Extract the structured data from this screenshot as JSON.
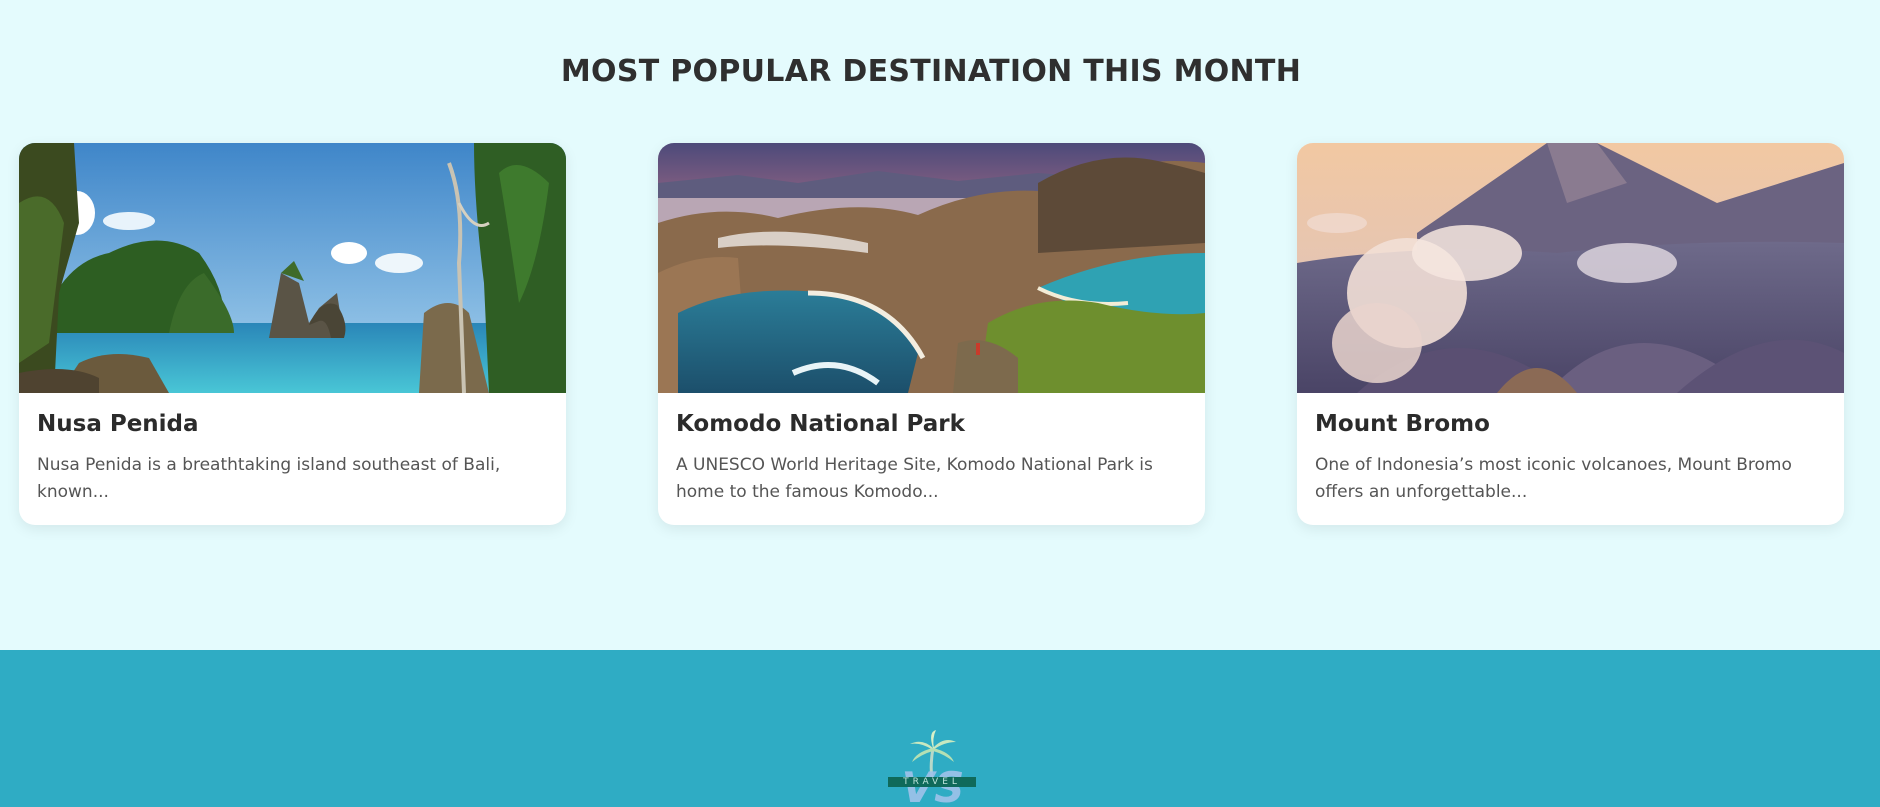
{
  "section": {
    "title": "MOST POPULAR DESTINATION THIS MONTH"
  },
  "cards": [
    {
      "title": "Nusa Penida",
      "description": "Nusa Penida is a breathtaking island southeast of Bali, known...",
      "image": "nusa-penida-photo"
    },
    {
      "title": "Komodo National Park",
      "description": "A UNESCO World Heritage Site, Komodo National Park is home to the famous Komodo...",
      "image": "komodo-national-park-photo"
    },
    {
      "title": "Mount Bromo",
      "description": "One of Indonesia’s most iconic volcanoes, Mount Bromo offers an unforgettable...",
      "image": "mount-bromo-photo"
    }
  ],
  "footer": {
    "logo_letters": "VS",
    "logo_word": "TRAVEL",
    "logo_icon": "palm-tree-icon"
  },
  "colors": {
    "page_background": "#e4fbfd",
    "footer_background": "#2facc4",
    "title_text": "#2f2f2f",
    "card_background": "#ffffff"
  }
}
